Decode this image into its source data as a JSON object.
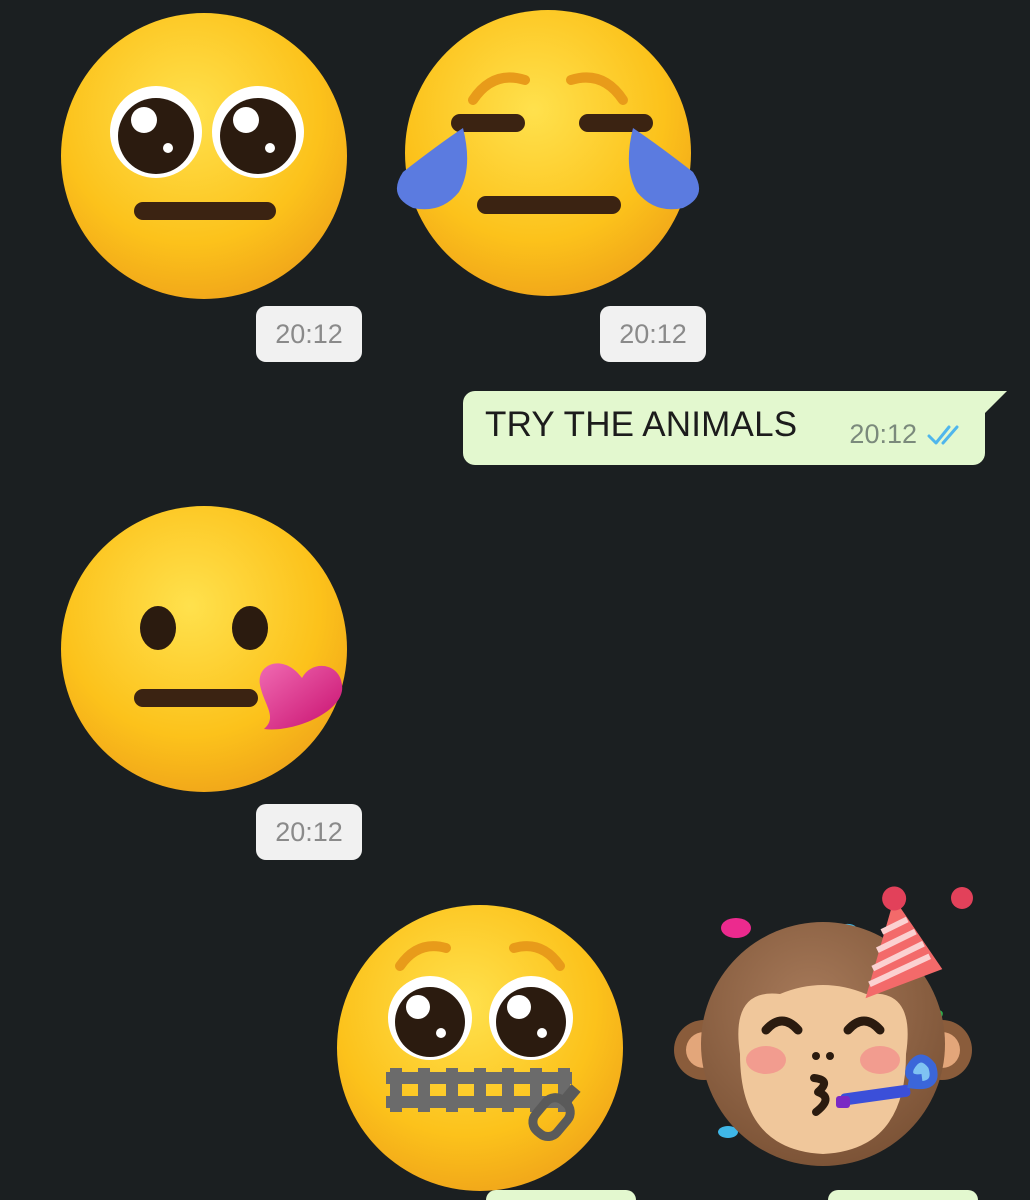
{
  "conversation": {
    "stickers": [
      {
        "name": "pleading-eyes-neutral-face",
        "time": "20:12"
      },
      {
        "name": "tears-neutral-face",
        "time": "20:12"
      },
      {
        "name": "neutral-face-blowing-heart",
        "time": "20:12"
      },
      {
        "name": "pleading-zipper-mouth-face"
      },
      {
        "name": "party-monkey-face"
      }
    ],
    "text_message": {
      "text": "TRY THE ANIMALS",
      "time": "20:12",
      "status": "read-double-check"
    }
  },
  "colors": {
    "background": "#1b1f21",
    "outgoing_bubble": "#e3f8cf",
    "time_chip": "#f1f1f1",
    "read_ticks": "#4fb6ec",
    "emoji_yellow": "#fcc21b"
  }
}
